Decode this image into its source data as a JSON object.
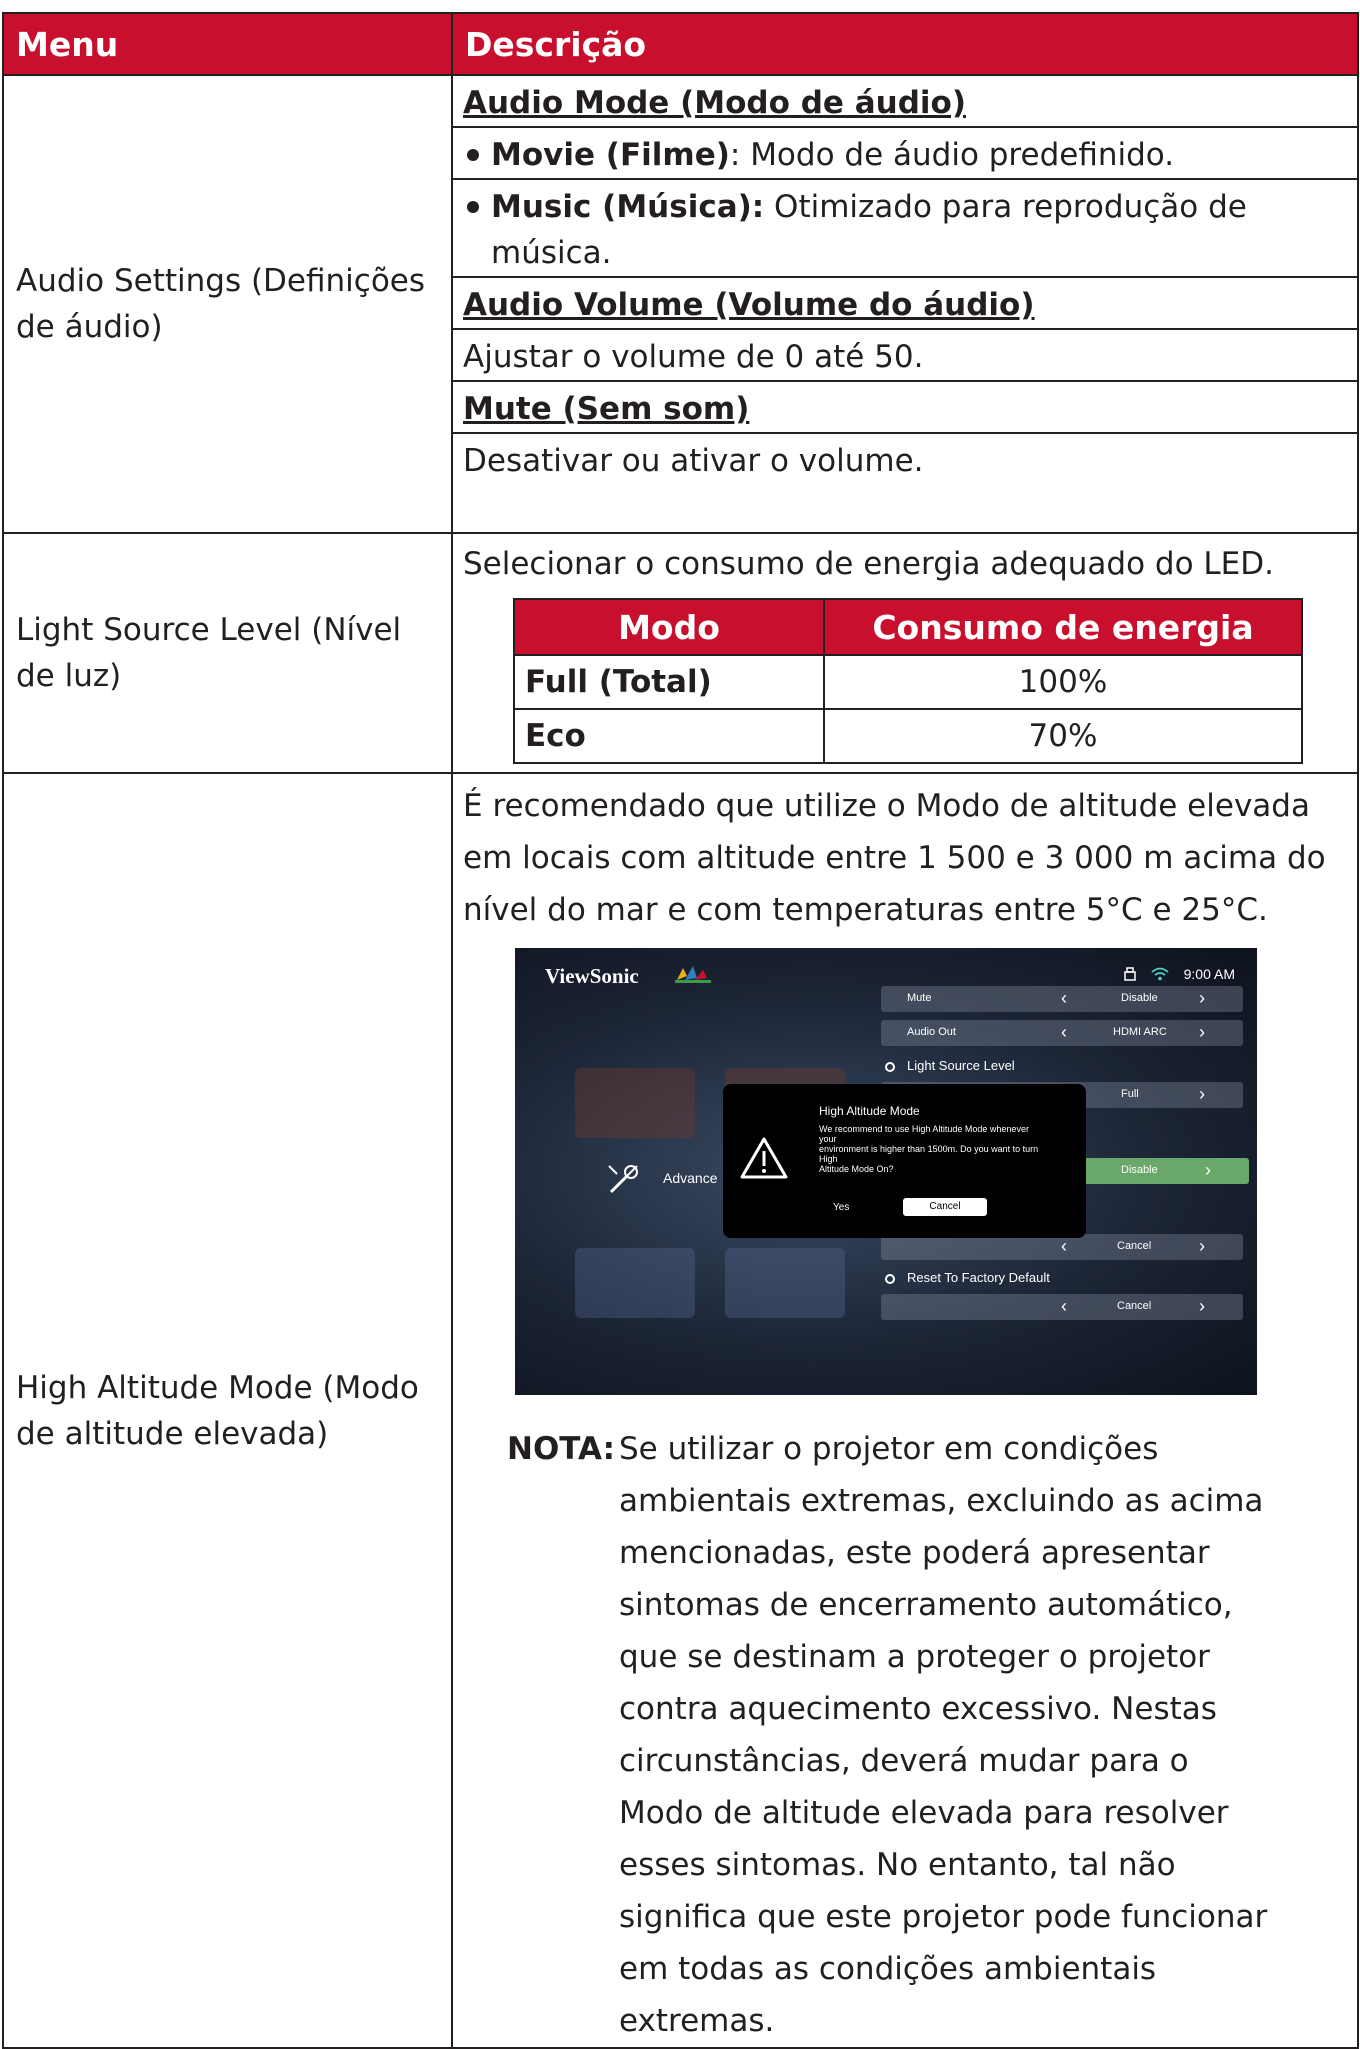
{
  "table": {
    "header_menu": "Menu",
    "header_desc": "Descrição"
  },
  "rows": {
    "audio": {
      "menu": "Audio Settings (Definições de áudio)",
      "mode_heading": "Audio Mode (Modo de áudio)",
      "movie_label": "Movie (Filme)",
      "movie_text": ": Modo de áudio predefinido.",
      "music_label": "Music (Música):",
      "music_text": " Otimizado para reprodução de",
      "music_text_cont": "música.",
      "volume_heading": "Audio Volume (Volume do áudio)",
      "volume_text": "Ajustar o volume de 0 até 50.",
      "mute_heading": "Mute (Sem som)",
      "mute_text": "Desativar ou ativar o volume."
    },
    "light": {
      "menu": "Light Source Level (Nível de luz)",
      "intro": "Selecionar o consumo de energia adequado do LED.",
      "col_mode": "Modo",
      "col_power": "Consumo de energia",
      "rows": [
        {
          "mode": "Full (Total)",
          "power": "100%"
        },
        {
          "mode": "Eco",
          "power": "70%"
        }
      ]
    },
    "altitude": {
      "menu": "High Altitude Mode (Modo de altitude elevada)",
      "intro": "É recomendado que utilize o Modo de altitude elevada em locais com altitude entre 1 500 e 3 000 m acima do nível do mar e com temperaturas entre 5°C e 25°C.",
      "nota_label": "NOTA:",
      "nota_text": "Se utilizar o projetor em condições ambientais extremas, excluindo as acima mencionadas, este poderá apresentar sintomas de encerramento automático, que se destinam a proteger o projetor contra aquecimento excessivo. Nestas circunstâncias, deverá mudar para o Modo de altitude elevada para resolver esses sintomas. No entanto, tal não significa que este projetor pode funcionar em todas as condições ambientais extremas."
    }
  },
  "screenshot": {
    "logo": "ViewSonic",
    "time": "9:00 AM",
    "rows": {
      "mute_label": "Mute",
      "mute_value": "Disable",
      "audio_out_label": "Audio Out",
      "audio_out_value": "HDMI ARC",
      "light_section": "Light Source Level",
      "light_value": "Full",
      "alt_value": "Disable",
      "cancel_value_1": "Cancel",
      "reset_section": "Reset To Factory Default",
      "cancel_value_2": "Cancel"
    },
    "advanced_label": "Advance",
    "dialog": {
      "title": "High Altitude Mode",
      "body": "We recommend to use High Altitude Mode whenever\nyour\n environment is higher than 1500m. Do you want to turn\nHigh\n Altitude Mode On?",
      "yes": "Yes",
      "cancel": "Cancel"
    }
  },
  "colors": {
    "header_red": "#c8102e",
    "text": "#231f20"
  }
}
